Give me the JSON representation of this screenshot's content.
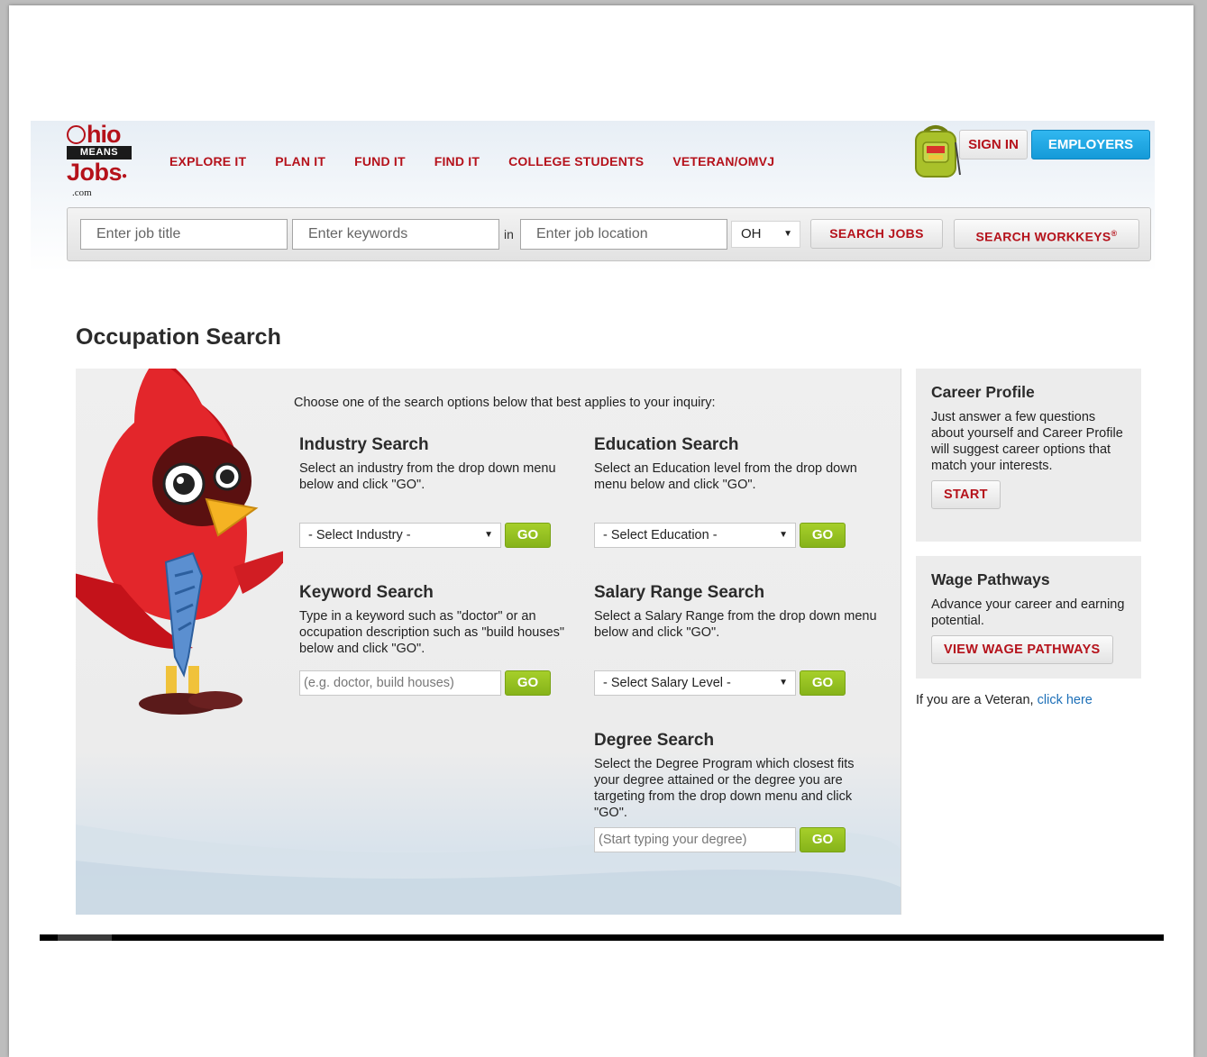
{
  "logo": {
    "ohio_rest": "hio",
    "means": "MEANS",
    "jobs": "Jobs",
    "com": ".com"
  },
  "nav": {
    "items": [
      {
        "label": "EXPLORE IT"
      },
      {
        "label": "PLAN IT"
      },
      {
        "label": "FUND IT"
      },
      {
        "label": "FIND IT"
      },
      {
        "label": "COLLEGE STUDENTS"
      },
      {
        "label": "VETERAN/OMVJ"
      }
    ]
  },
  "header": {
    "signin_label": "SIGN IN",
    "employers_label": "EMPLOYERS"
  },
  "searchbar": {
    "job_title_placeholder": "Enter job title",
    "keywords_placeholder": "Enter keywords",
    "in_label": "in",
    "location_placeholder": "Enter job location",
    "state_value": "OH",
    "search_jobs_label": "SEARCH JOBS",
    "search_workkeys_label": "SEARCH WORKKEYS",
    "registered_mark": "®"
  },
  "page": {
    "title": "Occupation Search",
    "intro": "Choose one of the search options below that best applies to your inquiry:"
  },
  "sections": {
    "industry": {
      "title": "Industry Search",
      "desc": "Select an industry from the drop down menu below and click \"GO\".",
      "select_value": "- Select Industry -",
      "go_label": "GO"
    },
    "education": {
      "title": "Education Search",
      "desc": "Select an Education level from the drop down menu below and click \"GO\".",
      "select_value": "- Select Education -",
      "go_label": "GO"
    },
    "keyword": {
      "title": "Keyword Search",
      "desc": "Type in a keyword such as \"doctor\" or an occupation description such as \"build houses\" below and click \"GO\".",
      "placeholder": "(e.g. doctor, build houses)",
      "go_label": "GO"
    },
    "salary": {
      "title": "Salary Range Search",
      "desc": "Select a Salary Range from the drop down menu below and click \"GO\".",
      "select_value": "- Select Salary Level -",
      "go_label": "GO"
    },
    "degree": {
      "title": "Degree Search",
      "desc": "Select the Degree Program which closest fits your degree attained or the degree you are targeting from the drop down menu and click \"GO\".",
      "placeholder": "(Start typing your degree)",
      "go_label": "GO"
    }
  },
  "sidebar": {
    "career_profile": {
      "title": "Career Profile",
      "desc": "Just answer a few questions about yourself and Career Profile will suggest career options that match your interests.",
      "button_label": "START"
    },
    "wage_pathways": {
      "title": "Wage Pathways",
      "desc": "Advance your career and earning potential.",
      "button_label": "VIEW WAGE PATHWAYS"
    },
    "veteran_text": "If you are a Veteran,",
    "veteran_link": "click here"
  },
  "colors": {
    "brand_red": "#b5121b",
    "employers_blue": "#1ea6e2",
    "go_green": "#95c11f",
    "link_blue": "#1c6fb8"
  }
}
